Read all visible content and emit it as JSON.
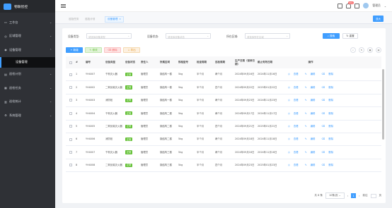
{
  "app": {
    "logo_text": "物联智控"
  },
  "sidebar": {
    "items": [
      {
        "label": "工作台",
        "icon": "monitor-icon"
      },
      {
        "label": "区域管理",
        "icon": "region-icon"
      },
      {
        "label": "设备管理",
        "icon": "device-icon"
      }
    ],
    "submenu": {
      "label": "设备管理"
    },
    "items_after": [
      {
        "label": "巡检计划",
        "icon": "plan-icon"
      },
      {
        "label": "巡检任务",
        "icon": "task-icon"
      },
      {
        "label": "巡检统计",
        "icon": "stats-icon"
      },
      {
        "label": "系统管理",
        "icon": "settings-icon"
      }
    ]
  },
  "header": {
    "badge": "99+",
    "user": "管理员"
  },
  "tabs": {
    "items": [
      "巡检任务",
      "巡检计划"
    ],
    "active": "设备管理",
    "zoom": "放大"
  },
  "filters": {
    "device_type": {
      "label": "设备类型:",
      "placeholder": "请选择设备类型"
    },
    "device_status": {
      "label": "设备状态:",
      "placeholder": "请选择设备状态"
    },
    "region": {
      "label": "所在区域:",
      "placeholder": "请选择所在区域"
    },
    "search": "搜索",
    "reset": "重置"
  },
  "toolbar": {
    "add": "新增",
    "edit": "修改",
    "delete": "删除",
    "export": "导出"
  },
  "table": {
    "headers": [
      "#",
      "编号",
      "设备类型",
      "设备状态",
      "责任人",
      "所属区域",
      "规格型号",
      "检查周期",
      "巡检周期",
      "生产日期（保修日期）",
      "截止有效日期",
      "操作"
    ],
    "rows": [
      {
        "idx": "1",
        "code": "YH4007",
        "type": "干粉灭火器",
        "status": "正常",
        "owner": "管理员",
        "region": "钢结构一楼",
        "spec": "5kg",
        "check": "半个月",
        "cycle": "两个月",
        "prod": "2024年09月16日",
        "expire": "2024年11月16日"
      },
      {
        "idx": "2",
        "code": "YH4002",
        "type": "二氧化碳灭火器",
        "status": "正常",
        "owner": "管理员",
        "region": "钢结构一楼",
        "spec": "5kg",
        "check": "半个月",
        "cycle": "四个月",
        "prod": "2024年09月22日",
        "expire": "2025年01月22日"
      },
      {
        "idx": "3",
        "code": "YH4003",
        "type": "消防栓",
        "status": "正常",
        "owner": "管理员",
        "region": "钢结构一楼",
        "spec": "5kg",
        "check": "半个月",
        "cycle": "两个月",
        "prod": "2024年09月23日",
        "expire": "2024年11月23日"
      },
      {
        "idx": "4",
        "code": "YH4004",
        "type": "干粉灭火器",
        "status": "正常",
        "owner": "管理员",
        "region": "钢结构二楼",
        "spec": "5kg",
        "check": "半个月",
        "cycle": "两个月",
        "prod": "2024年09月17日",
        "expire": "2024年11月17日"
      },
      {
        "idx": "5",
        "code": "YH4005",
        "type": "二氧化碳灭火器",
        "status": "正常",
        "owner": "管理员",
        "region": "钢结构二楼",
        "spec": "5kg",
        "check": "半个月",
        "cycle": "四个月",
        "prod": "2024年09月21日",
        "expire": "2025年01月21日"
      },
      {
        "idx": "6",
        "code": "YH4006",
        "type": "消防栓",
        "status": "正常",
        "owner": "管理员",
        "region": "钢结构二楼",
        "spec": "5kg",
        "check": "半个月",
        "cycle": "两个月",
        "prod": "2024年09月18日",
        "expire": "2024年11月18日"
      },
      {
        "idx": "7",
        "code": "YH4007",
        "type": "干粉灭火器",
        "status": "正常",
        "owner": "管理员",
        "region": "钢结构三楼",
        "spec": "5kg",
        "check": "半个月",
        "cycle": "两个月",
        "prod": "2024年09月16日",
        "expire": "2024年11月16日"
      },
      {
        "idx": "8",
        "code": "YH4008",
        "type": "二氧化碳灭火器",
        "status": "正常",
        "owner": "管理员",
        "region": "钢结构三楼",
        "spec": "5kg",
        "check": "半个月",
        "cycle": "四个月",
        "prod": "2024年09月23日",
        "expire": "2025年01月23日"
      }
    ],
    "ops": [
      "查看",
      "编辑",
      "删除"
    ]
  },
  "pagination": {
    "total": "共 8 条",
    "page_size": "10条/页",
    "current": "1",
    "goto": "前往",
    "page_unit": "页"
  },
  "colors": {
    "primary": "#409eff",
    "sidebar": "#2f3136",
    "success": "#67c23a",
    "danger": "#f56c6c",
    "warning": "#e6a23c"
  }
}
